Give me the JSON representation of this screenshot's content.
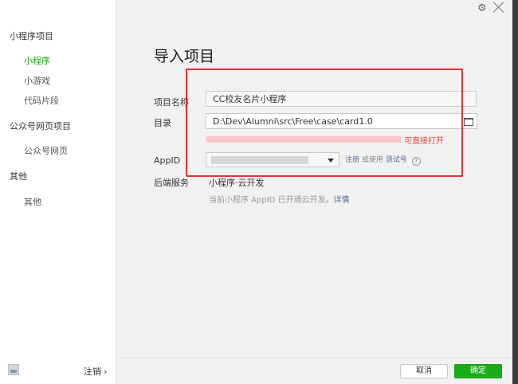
{
  "sidebar": {
    "groups": [
      {
        "label": "小程序项目",
        "items": [
          "小程序",
          "小游戏",
          "代码片段"
        ]
      },
      {
        "label": "公众号网页项目",
        "items": [
          "公众号网页"
        ]
      },
      {
        "label": "其他",
        "items": [
          "其他"
        ]
      }
    ],
    "active_item": "小程序",
    "logout_label": "注销",
    "logout_chevron": "›"
  },
  "dialog": {
    "title": "导入项目",
    "fields": {
      "project_name": {
        "label": "项目名称",
        "value": "CC校友名片小程序"
      },
      "directory": {
        "label": "目录",
        "value": "D:\\Dev\\Alumni\\src\\Free\\case\\card1.0"
      },
      "directory_error": "可直接打开",
      "appid": {
        "label": "AppID"
      },
      "register_link": "注册",
      "or_use_text": "或使用",
      "test_account_link": "测试号",
      "help_icon": "?",
      "backend_service": {
        "label": "后端服务",
        "value": "小程序·云开发"
      },
      "cloud_hint": "当前小程序 AppID 已开通云开发。",
      "cloud_hint_link": "详情"
    }
  },
  "buttons": {
    "cancel": "取消",
    "confirm": "确定"
  },
  "icons": {
    "settings": "gear-icon",
    "close": "close-icon",
    "folder": "folder-icon",
    "help": "help-circle-icon",
    "dropdown": "caret-down-icon"
  },
  "colors": {
    "accent_green": "#1aad19",
    "link_blue": "#576b95",
    "error_red": "#e64340",
    "highlight_box": "#e4322e"
  }
}
